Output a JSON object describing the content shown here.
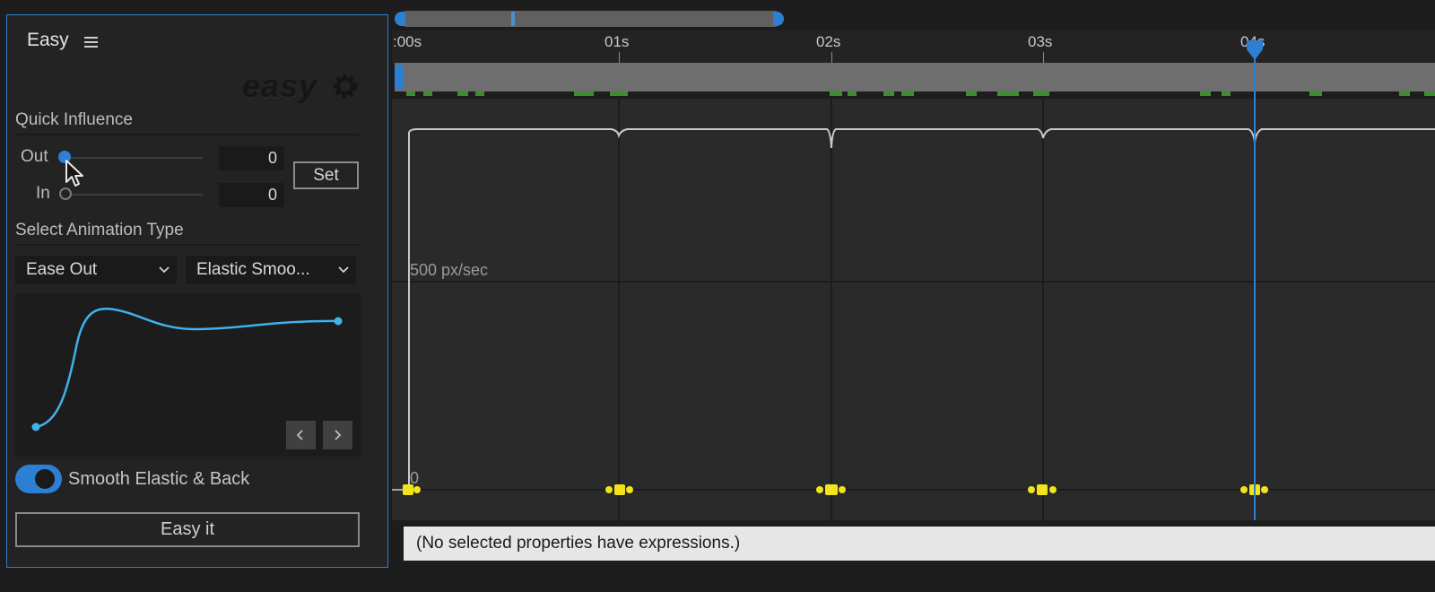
{
  "panel": {
    "title": "Easy",
    "logo_text": "easy",
    "quick_influence": {
      "title": "Quick Influence",
      "out_label": "Out",
      "in_label": "In",
      "out_value": "0",
      "in_value": "0",
      "set_label": "Set"
    },
    "animation_type": {
      "title": "Select Animation Type",
      "ease_selected": "Ease Out",
      "curve_selected": "Elastic Smoo..."
    },
    "toggle_label": "Smooth Elastic & Back",
    "toggle_on": true,
    "easy_it_label": "Easy it"
  },
  "timeline": {
    "ticks": [
      ":00s",
      "01s",
      "02s",
      "03s",
      "04s"
    ],
    "graph_label": "500 px/sec",
    "zero_label": "0",
    "expression_message": "(No selected properties have expressions.)"
  },
  "colors": {
    "accent": "#2d7fd3",
    "curve": "#3fb2ea",
    "keyframe": "#f2e31c",
    "marker": "#3e8c2f"
  }
}
